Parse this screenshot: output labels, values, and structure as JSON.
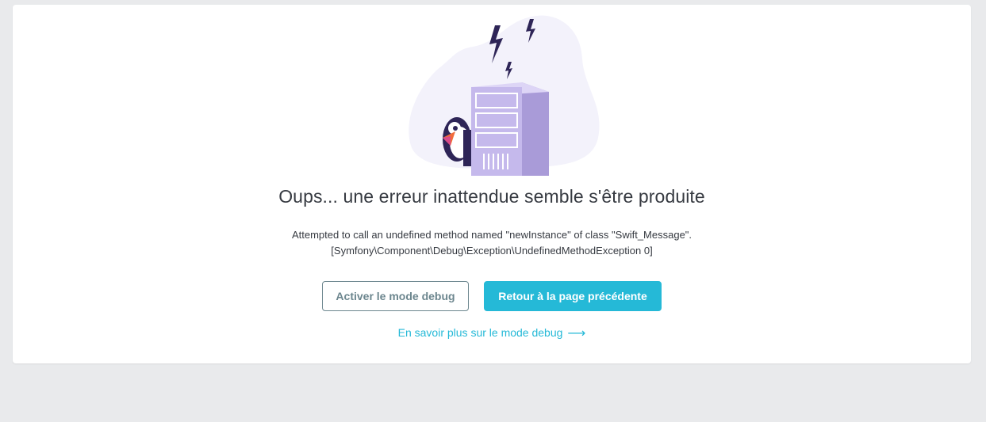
{
  "error": {
    "title": "Oups... une erreur inattendue semble s'être produite",
    "message_line1": "Attempted to call an undefined method named \"newInstance\" of class \"Swift_Message\".",
    "message_line2": "[Symfony\\Component\\Debug\\Exception\\UndefinedMethodException 0]"
  },
  "actions": {
    "debug_button": "Activer le mode debug",
    "back_button": "Retour à la page précédente",
    "learn_more_link": "En savoir plus sur le mode debug",
    "learn_more_arrow": "⟶"
  },
  "colors": {
    "accent": "#25b9d7",
    "outline": "#6c868e",
    "text": "#363a41",
    "background": "#e9eaec",
    "server": "#c5b9ec",
    "bolt": "#2e2557"
  },
  "icons": {
    "illustration": "server-error-illustration",
    "arrow": "arrow-right-icon"
  }
}
